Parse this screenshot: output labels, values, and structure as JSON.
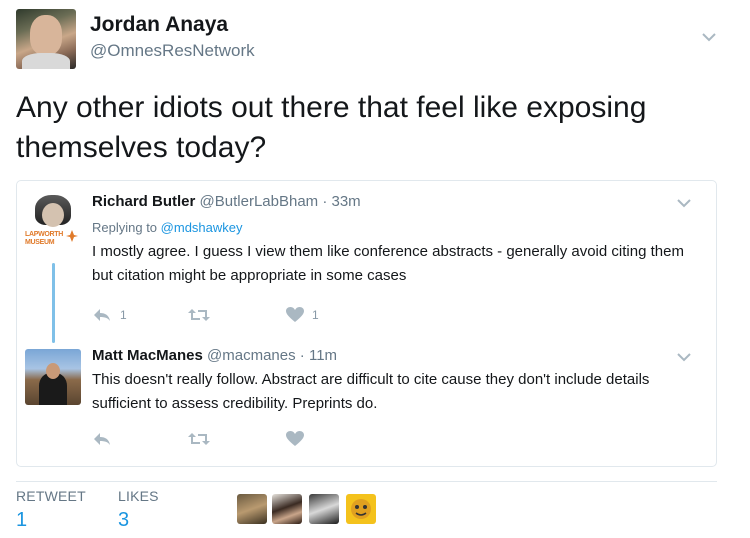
{
  "author": {
    "name": "Jordan Anaya",
    "handle": "@OmnesResNetwork"
  },
  "tweet": {
    "text": "Any other idiots out there that feel like exposing themselves today?"
  },
  "quoted_thread": [
    {
      "name": "Richard Butler",
      "handle": "@ButlerLabBham",
      "time": "33m",
      "replying_prefix": "Replying to",
      "replying_to": "@mdshawkey",
      "avatar_label": "LAPWORTH MUSEUM",
      "text": "I mostly agree. I guess I view them like conference abstracts - generally avoid citing them but citation might be appropriate in some cases",
      "replies": "1",
      "retweets": "",
      "likes": "1"
    },
    {
      "name": "Matt MacManes",
      "handle": "@macmanes",
      "time": "11m",
      "text": "This doesn't really follow. Abstract are difficult to cite cause they don't include details sufficient to assess credibility. Preprints do.",
      "replies": "",
      "retweets": "",
      "likes": ""
    }
  ],
  "stats": {
    "retweets_label": "RETWEET",
    "retweets_count": "1",
    "likes_label": "LIKES",
    "likes_count": "3"
  },
  "colors": {
    "link": "#1b95e0",
    "muted": "#657786",
    "thread_line": "#7fc0e8",
    "border": "#e1e8ed"
  },
  "icons": [
    "chevron-down-icon",
    "reply-icon",
    "retweet-icon",
    "heart-icon"
  ]
}
